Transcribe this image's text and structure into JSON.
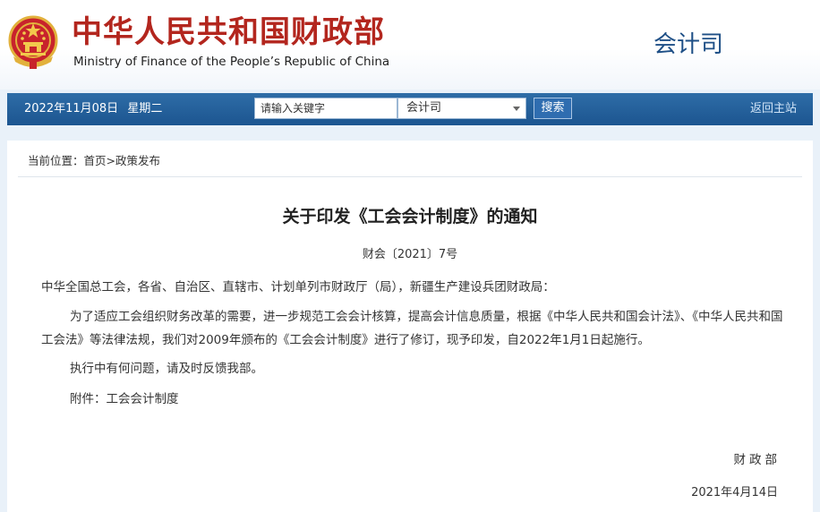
{
  "header": {
    "ministry_cn": "中华人民共和国财政部",
    "ministry_en": "Ministry of Finance of the People’s Republic of China",
    "department": "会计司",
    "emblem_icon": "national-emblem-icon",
    "accent_red": "#b3261e",
    "accent_blue": "#1e4f86"
  },
  "navbar": {
    "date": "2022年11月08日",
    "weekday": "星期二",
    "search_placeholder": "请输入关键字",
    "scope_selected": "会计司",
    "scope_icon": "chevron-down-icon",
    "search_button": "搜索",
    "home_link": "返回主站",
    "bg_color": "#1c5590"
  },
  "breadcrumb": {
    "label": "当前位置：",
    "home": "首页",
    "separator": ">",
    "section": "政策发布"
  },
  "article": {
    "title": "关于印发《工会会计制度》的通知",
    "doc_number": "财会〔2021〕7号",
    "addressee": "中华全国总工会，各省、自治区、直辖市、计划单列市财政厅（局），新疆生产建设兵团财政局：",
    "body1": "为了适应工会组织财务改革的需要，进一步规范工会会计核算，提高会计信息质量，根据《中华人民共和国会计法》、《中华人民共和国工会法》等法律法规，我们对2009年颁布的《工会会计制度》进行了修订，现予印发，自2022年1月1日起施行。",
    "body2": "执行中有何问题，请及时反馈我部。",
    "attachment": "附件：工会会计制度",
    "signer": "财政部",
    "date": "2021年4月14日"
  }
}
